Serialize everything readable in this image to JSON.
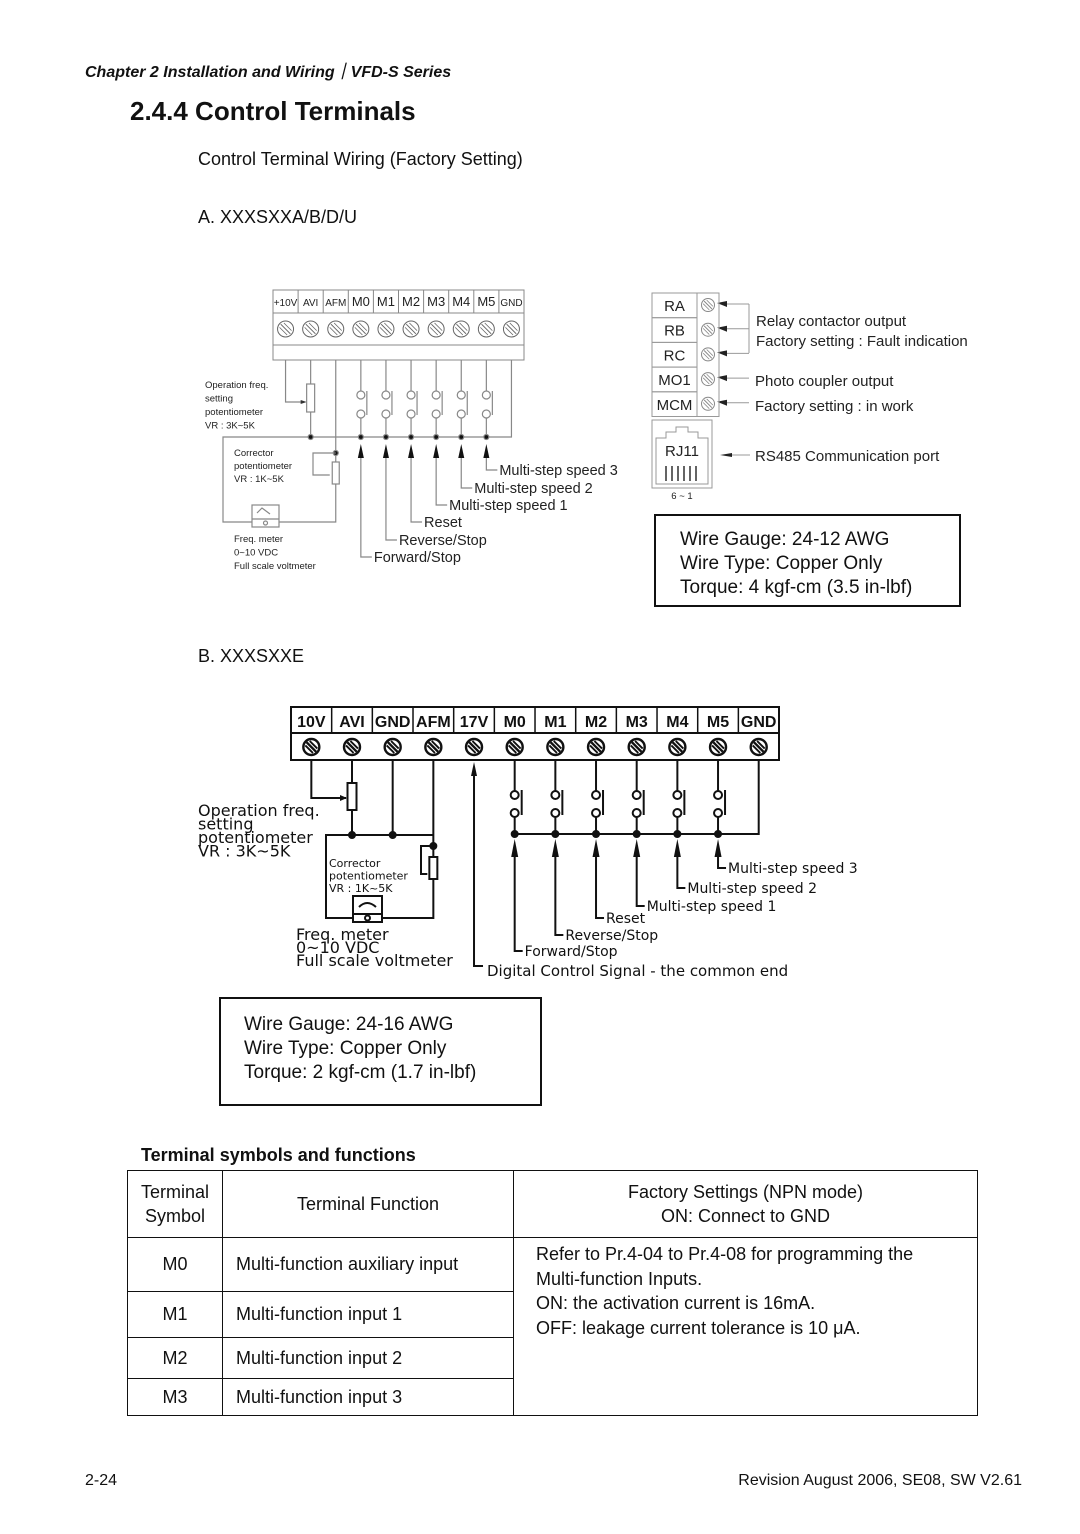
{
  "header": {
    "chapter": "Chapter 2 Installation and Wiring｜VFD-S Series"
  },
  "section": {
    "title": "2.4.4 Control Terminals",
    "subtitle": "Control Terminal Wiring (Factory Setting)"
  },
  "diagram_a": {
    "label": "A. XXXSXXA/B/D/U",
    "terminals": [
      "+10V",
      "AVI",
      "AFM",
      "M0",
      "M1",
      "M2",
      "M3",
      "M4",
      "M5",
      "GND"
    ],
    "op_freq_pot": [
      "Operation freq.",
      "setting",
      "potentiometer",
      "VR : 3K~5K"
    ],
    "corrector_pot": [
      "Corrector",
      "potentiometer",
      "VR : 1K~5K"
    ],
    "freq_meter": [
      "Freq. meter",
      "0~10 VDC",
      "Full scale voltmeter"
    ],
    "signals": [
      "Forward/Stop",
      "Reverse/Stop",
      "Reset",
      "Multi-step speed 1",
      "Multi-step speed 2",
      "Multi-step speed 3"
    ],
    "relay_terminals": [
      "RA",
      "RB",
      "RC",
      "MO1",
      "MCM"
    ],
    "relay_desc": [
      "Relay contactor output",
      "Factory setting : Fault indication"
    ],
    "photo_desc": [
      "Photo coupler output",
      "Factory setting : in work"
    ],
    "rj11": {
      "label": "RJ11",
      "pins": "6 ~ 1",
      "desc": "RS485 Communication port"
    },
    "spec": [
      "Wire Gauge: 24-12 AWG",
      "Wire Type: Copper Only",
      "Torque: 4 kgf-cm (3.5 in-lbf)"
    ]
  },
  "diagram_b": {
    "label": "B. XXXSXXE",
    "terminals": [
      "10V",
      "AVI",
      "GND",
      "AFM",
      "17V",
      "M0",
      "M1",
      "M2",
      "M3",
      "M4",
      "M5",
      "GND"
    ],
    "op_freq_pot": [
      "Operation freq.",
      "setting",
      "potentiometer",
      "VR : 3K~5K"
    ],
    "corrector_pot": [
      "Corrector",
      "potentiometer",
      "VR : 1K~5K"
    ],
    "freq_meter": [
      "Freq. meter",
      "0~10 VDC",
      "Full scale voltmeter"
    ],
    "signals": [
      "Forward/Stop",
      "Reverse/Stop",
      "Reset",
      "Multi-step speed 1",
      "Multi-step speed 2",
      "Multi-step speed 3"
    ],
    "common_end": "Digital Control Signal - the common end",
    "spec": [
      "Wire Gauge: 24-16 AWG",
      "Wire Type: Copper Only",
      "Torque: 2 kgf-cm (1.7 in-lbf)"
    ]
  },
  "table": {
    "title": "Terminal symbols and functions",
    "headers": {
      "symbol": [
        "Terminal",
        "Symbol"
      ],
      "function": "Terminal Function",
      "factory": [
        "Factory Settings (NPN mode)",
        "ON: Connect to GND"
      ]
    },
    "rows": [
      {
        "symbol": "M0",
        "function": "Multi-function auxiliary input"
      },
      {
        "symbol": "M1",
        "function": "Multi-function input 1"
      },
      {
        "symbol": "M2",
        "function": "Multi-function input 2"
      },
      {
        "symbol": "M3",
        "function": "Multi-function input 3"
      }
    ],
    "factory_note": [
      "Refer to Pr.4-04 to Pr.4-08 for programming the",
      "Multi-function Inputs.",
      "ON:  the activation current is 16mA.",
      "OFF:  leakage current tolerance is 10 μA."
    ]
  },
  "footer": {
    "page": "2-24",
    "revision": "Revision August 2006, SE08, SW V2.61"
  }
}
